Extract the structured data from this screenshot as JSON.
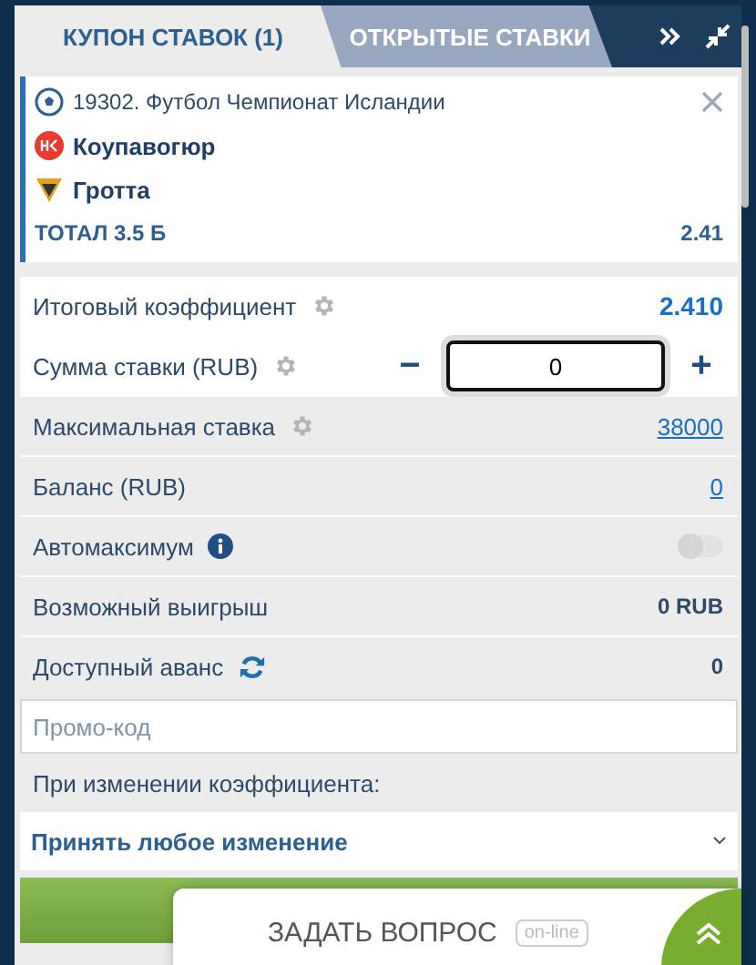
{
  "tabs": [
    {
      "label": "КУПОН СТАВОК (1)",
      "selected": true
    },
    {
      "label": "ОТКРЫТЫЕ СТАВКИ",
      "selected": false
    }
  ],
  "coupon": {
    "event": "19302. Футбол Чемпионат Исландии",
    "teams": [
      "Коупавогюр",
      "Гротта"
    ],
    "market": "ТОТАЛ 3.5 Б",
    "odds": "2.41"
  },
  "total_odds": {
    "label": "Итоговый коэффициент",
    "value": "2.410"
  },
  "stake": {
    "label": "Сумма ставки (RUB)",
    "minus": "−",
    "value": "0",
    "plus": "+"
  },
  "max_stake": {
    "label": "Максимальная ставка",
    "value": "38000"
  },
  "balance": {
    "label": "Баланс (RUB)",
    "value": "0"
  },
  "auto_max": {
    "label": "Автомаксимум",
    "on": false
  },
  "possible_win": {
    "label": "Возможный выигрыш",
    "value": "0 RUB"
  },
  "advance": {
    "label": "Доступный аванс",
    "value": "0"
  },
  "promo": {
    "placeholder": "Промо-код"
  },
  "odds_change": {
    "label": "При изменении коэффициента:",
    "value": "Принять любое изменение"
  },
  "chat": {
    "label": "ЗАДАТЬ ВОПРОС",
    "badge": "on-line"
  }
}
